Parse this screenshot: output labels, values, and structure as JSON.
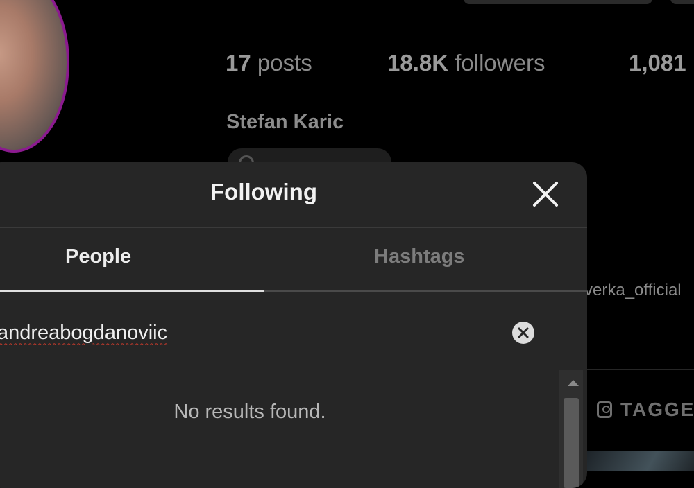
{
  "profile": {
    "stats": {
      "posts_count": "17",
      "posts_label": "posts",
      "followers_count": "18.8K",
      "followers_label": "followers",
      "following_count": "1,081"
    },
    "name": "Stefan Karic",
    "visible_username": "verka_official",
    "tagged_tab_label": "TAGGE",
    "ring_color": "#8b1a8f"
  },
  "modal": {
    "title": "Following",
    "close_icon": "close-icon",
    "tabs": [
      {
        "label": "People",
        "active": true
      },
      {
        "label": "Hashtags",
        "active": false
      }
    ],
    "search": {
      "value": "andreabogdanoviic",
      "clear_icon": "clear-circle-icon"
    },
    "empty_message": "No results found."
  }
}
